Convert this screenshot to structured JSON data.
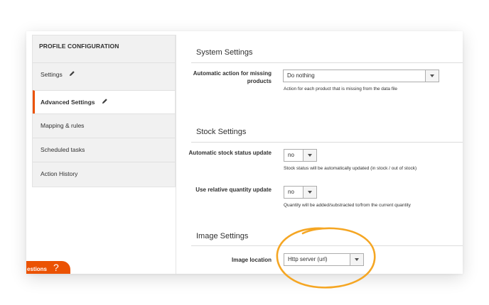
{
  "sidebar": {
    "title": "PROFILE CONFIGURATION",
    "items": [
      {
        "label": "Settings",
        "icon": "pencil-icon"
      },
      {
        "label": "Advanced Settings",
        "icon": "pencil-icon",
        "active": true
      },
      {
        "label": "Mapping & rules"
      },
      {
        "label": "Scheduled tasks"
      },
      {
        "label": "Action History"
      }
    ]
  },
  "system_settings": {
    "title": "System Settings",
    "missing_products_label": "Automatic action for missing products",
    "missing_products_value": "Do nothing",
    "missing_products_note": "Action for each product that is missing from the data file"
  },
  "stock_settings": {
    "title": "Stock Settings",
    "auto_stock_label": "Automatic stock status update",
    "auto_stock_value": "no",
    "auto_stock_note": "Stock status will be automatically updated (in stock / out of stock)",
    "relative_qty_label": "Use relative quantity update",
    "relative_qty_value": "no",
    "relative_qty_note": "Quantity will be added/substracted to/from the current quantity"
  },
  "image_settings": {
    "title": "Image Settings",
    "image_location_label": "Image location",
    "image_location_value": "Http server (url)"
  },
  "help_tab": {
    "label": "estions",
    "icon": "question-icon",
    "glyph": "?"
  },
  "colors": {
    "accent": "#eb5202",
    "highlight_circle": "#f5a623"
  }
}
